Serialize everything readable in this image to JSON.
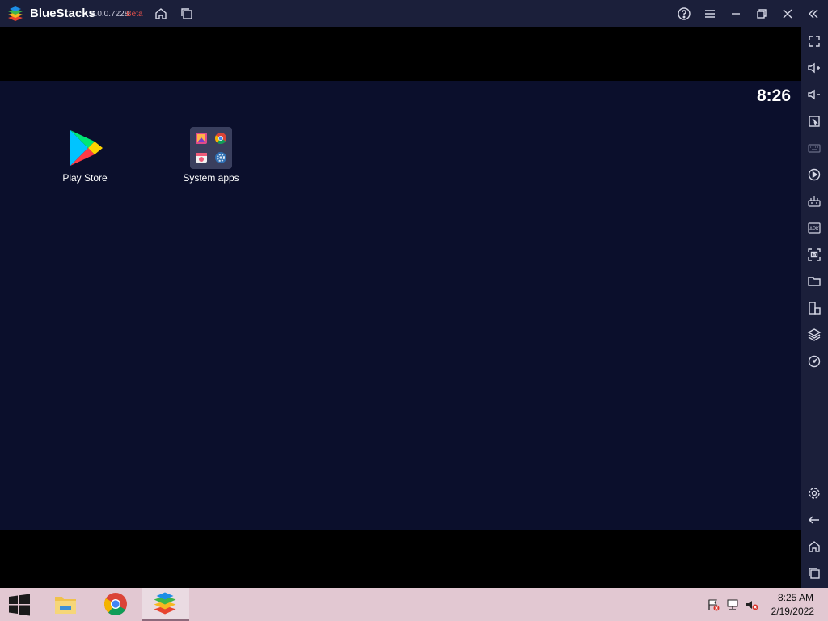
{
  "window": {
    "app_name": "BlueStacks",
    "version": "5.0.0.7228",
    "beta": "Beta"
  },
  "titlebar": {
    "icons": [
      "home-icon",
      "multi-instance-icon",
      "help-icon",
      "menu-icon",
      "minimize-icon",
      "restore-icon",
      "close-icon",
      "collapse-sidebar-icon"
    ]
  },
  "android": {
    "clock": "8:26",
    "apps": [
      {
        "label": "Play Store",
        "icon": "play-store-icon"
      },
      {
        "label": "System apps",
        "icon": "folder-icon"
      }
    ]
  },
  "sidebar": {
    "icons": [
      "fullscreen-icon",
      "volume-up-icon",
      "volume-down-icon",
      "pointer-icon",
      "keyboard-icon",
      "macro-icon",
      "game-controls-icon",
      "apk-install-icon",
      "screenshot-icon",
      "folder-icon",
      "rotate-icon",
      "multi-instance-icon",
      "eco-mode-icon",
      "settings-icon",
      "back-icon",
      "home-icon",
      "recent-apps-icon"
    ]
  },
  "taskbar": {
    "apps": [
      "windows-start-icon",
      "file-explorer-icon",
      "chrome-icon",
      "bluestacks-icon"
    ],
    "time": "8:25 AM",
    "date": "2/19/2022"
  },
  "colors": {
    "titlebar": "#1b1f3a",
    "screen": "#0b0f2c",
    "taskbar": "#e2c8d2",
    "beta": "#e0504a"
  }
}
